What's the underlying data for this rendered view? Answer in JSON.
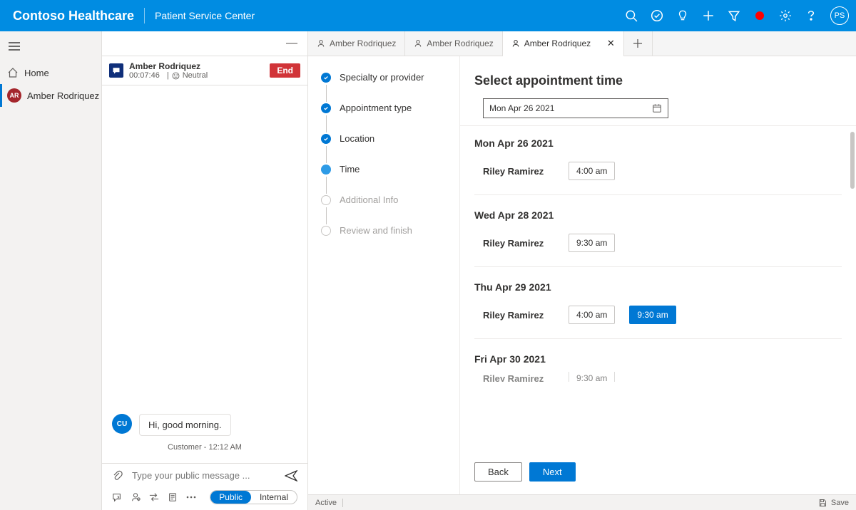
{
  "brand": {
    "name": "Contoso Healthcare",
    "app": "Patient Service Center"
  },
  "profile_initials": "PS",
  "leftnav": {
    "home": "Home",
    "patient": "Amber Rodriquez",
    "patient_initials": "AR"
  },
  "conversation": {
    "name": "Amber Rodriquez",
    "duration": "00:07:46",
    "sentiment": "Neutral",
    "end_label": "End",
    "message_avatar": "CU",
    "message_text": "Hi, good morning.",
    "message_meta": "Customer - 12:12 AM",
    "compose_placeholder": "Type your public message ...",
    "public_label": "Public",
    "internal_label": "Internal"
  },
  "tabs": [
    {
      "label": "Amber Rodriquez",
      "active": false
    },
    {
      "label": "Amber Rodriquez",
      "active": false
    },
    {
      "label": "Amber Rodriquez",
      "active": true
    }
  ],
  "wizard": {
    "steps": [
      {
        "label": "Specialty or provider",
        "state": "done"
      },
      {
        "label": "Appointment type",
        "state": "done"
      },
      {
        "label": "Location",
        "state": "done"
      },
      {
        "label": "Time",
        "state": "current"
      },
      {
        "label": "Additional Info",
        "state": "inactive"
      },
      {
        "label": "Review and finish",
        "state": "inactive"
      }
    ]
  },
  "detail": {
    "title": "Select appointment time",
    "date_value": "Mon Apr 26 2021",
    "days": [
      {
        "label": "Mon Apr 26 2021",
        "provider": "Riley Ramirez",
        "slots": [
          {
            "t": "4:00 am",
            "selected": false
          }
        ]
      },
      {
        "label": "Wed Apr 28 2021",
        "provider": "Riley Ramirez",
        "slots": [
          {
            "t": "9:30 am",
            "selected": false
          }
        ]
      },
      {
        "label": "Thu Apr 29 2021",
        "provider": "Riley Ramirez",
        "slots": [
          {
            "t": "4:00 am",
            "selected": false
          },
          {
            "t": "9:30 am",
            "selected": true
          }
        ]
      },
      {
        "label": "Fri Apr 30 2021",
        "provider": "Riley Ramirez",
        "slots": [
          {
            "t": "9:30 am",
            "selected": false
          }
        ],
        "cutoff": true
      }
    ],
    "back": "Back",
    "next": "Next"
  },
  "status": {
    "state": "Active",
    "save": "Save"
  }
}
